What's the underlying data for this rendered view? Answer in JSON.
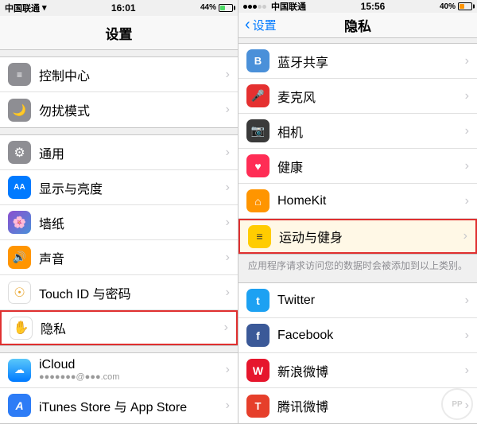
{
  "left": {
    "statusBar": {
      "carrier": "中国联通",
      "wifi": "WiFi",
      "time": "16:01",
      "batteryPercent": "44%",
      "batteryCarrier2": "中国联通"
    },
    "navTitle": "设置",
    "groups": [
      {
        "items": [
          {
            "icon": "gray",
            "iconChar": "≡",
            "label": "控制中心",
            "hasChevron": true,
            "name": "control-center"
          },
          {
            "icon": "dark-gray",
            "iconChar": "🌙",
            "label": "勿扰模式",
            "hasChevron": true,
            "name": "do-not-disturb"
          }
        ]
      },
      {
        "items": [
          {
            "icon": "gray",
            "iconChar": "⚙",
            "label": "通用",
            "hasChevron": true,
            "name": "general"
          },
          {
            "icon": "blue",
            "iconChar": "AA",
            "label": "显示与亮度",
            "hasChevron": true,
            "name": "display"
          },
          {
            "icon": "wallpaper",
            "iconChar": "🌸",
            "label": "墙纸",
            "hasChevron": true,
            "name": "wallpaper"
          },
          {
            "icon": "orange",
            "iconChar": "🔊",
            "label": "声音",
            "hasChevron": true,
            "name": "sound"
          },
          {
            "icon": "fingerprint",
            "iconChar": "👆",
            "label": "Touch ID 与密码",
            "hasChevron": true,
            "name": "touch-id",
            "iconColor": "#e8a020"
          },
          {
            "icon": "hand",
            "iconChar": "✋",
            "label": "隐私",
            "hasChevron": true,
            "name": "privacy",
            "highlighted": true,
            "iconColor": "#888"
          }
        ]
      },
      {
        "items": [
          {
            "icon": "icloud",
            "iconChar": "☁",
            "label": "iCloud",
            "sublabel": "apple_id_text",
            "hasChevron": true,
            "name": "icloud",
            "iconType": "icloud"
          },
          {
            "icon": "appstore",
            "iconChar": "A",
            "label": "iTunes Store 与 App Store",
            "hasChevron": true,
            "name": "itunes-appstore"
          }
        ]
      }
    ]
  },
  "right": {
    "statusBar": {
      "carrier": "中国联通",
      "time": "15:56",
      "batteryPercent": "40%"
    },
    "navBack": "设置",
    "navTitle": "隐私",
    "groups": [
      {
        "items": [
          {
            "icon": "blue-mid",
            "iconChar": "𝔹",
            "label": "蓝牙共享",
            "hasChevron": true,
            "name": "bluetooth"
          },
          {
            "icon": "red",
            "iconChar": "🎤",
            "label": "麦克风",
            "hasChevron": true,
            "name": "microphone"
          },
          {
            "icon": "dark",
            "iconChar": "📷",
            "label": "相机",
            "hasChevron": true,
            "name": "camera"
          },
          {
            "icon": "pink",
            "iconChar": "♥",
            "label": "健康",
            "hasChevron": true,
            "name": "health"
          },
          {
            "icon": "orange",
            "iconChar": "⌂",
            "label": "HomeKit",
            "hasChevron": true,
            "name": "homekit"
          },
          {
            "icon": "yellow",
            "iconChar": "🏃",
            "label": "运动与健身",
            "hasChevron": true,
            "name": "motion",
            "highlighted": true
          }
        ]
      },
      {
        "hint": "应用程序请求访问您的数据时会被添加到以上类别。"
      },
      {
        "items": [
          {
            "icon": "twitter-icon",
            "iconChar": "t",
            "label": "Twitter",
            "hasChevron": true,
            "name": "twitter"
          },
          {
            "icon": "facebook-icon",
            "iconChar": "f",
            "label": "Facebook",
            "hasChevron": true,
            "name": "facebook"
          },
          {
            "icon": "weibo-icon",
            "iconChar": "W",
            "label": "新浪微博",
            "hasChevron": true,
            "name": "weibo"
          },
          {
            "icon": "tencent-icon",
            "iconChar": "T",
            "label": "腾讯微博",
            "hasChevron": true,
            "name": "tencent"
          }
        ]
      }
    ]
  }
}
